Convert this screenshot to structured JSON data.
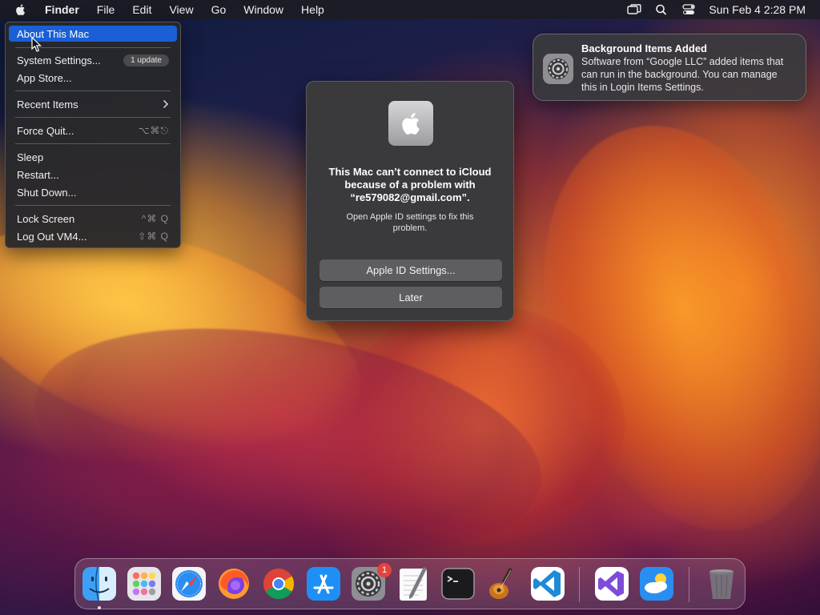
{
  "menubar": {
    "app_name": "Finder",
    "menus": [
      "File",
      "Edit",
      "View",
      "Go",
      "Window",
      "Help"
    ],
    "clock": "Sun Feb 4  2:28 PM",
    "status_icons": [
      "screen-mirroring-icon",
      "search-icon",
      "control-center-icon"
    ]
  },
  "apple_menu": {
    "about": "About This Mac",
    "system_settings": "System Settings...",
    "update_badge": "1 update",
    "app_store": "App Store...",
    "recent_items": "Recent Items",
    "force_quit": "Force Quit...",
    "force_quit_shortcut": "⌥⌘⎋",
    "sleep": "Sleep",
    "restart": "Restart...",
    "shut_down": "Shut Down...",
    "lock_screen": "Lock Screen",
    "lock_screen_shortcut": "^⌘ Q",
    "log_out": "Log Out VM4...",
    "log_out_shortcut": "⇧⌘ Q"
  },
  "notification": {
    "title": "Background Items Added",
    "body": "Software from “Google LLC” added items that can run in the background. You can manage this in Login Items Settings."
  },
  "dialog": {
    "title": "This Mac can’t connect to iCloud because of a problem with “re579082@gmail.com”.",
    "message": "Open Apple ID settings to fix this problem.",
    "primary_button": "Apple ID Settings...",
    "secondary_button": "Later"
  },
  "dock": {
    "apps": [
      "Finder",
      "Launchpad",
      "Safari",
      "Firefox",
      "Chrome",
      "App Store",
      "System Settings",
      "TextEdit",
      "Terminal",
      "GarageBand",
      "Visual Studio Code",
      "Visual Studio",
      "Weather",
      "Trash"
    ],
    "system_settings_badge": "1"
  },
  "colors": {
    "selection": "#1a5fd6",
    "badge_red": "#e5413d"
  }
}
